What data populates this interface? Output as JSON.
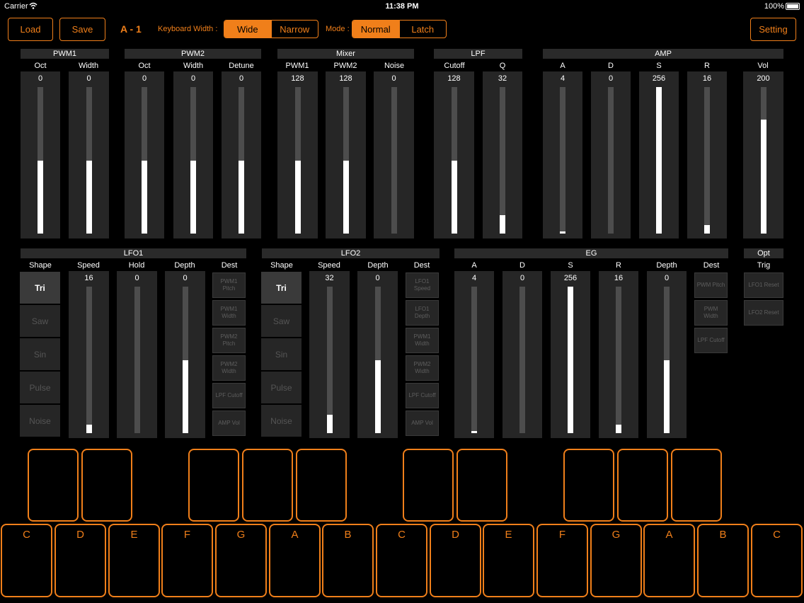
{
  "status": {
    "carrier": "Carrier",
    "time": "11:38 PM",
    "battery": "100%"
  },
  "top": {
    "load": "Load",
    "save": "Save",
    "patch": "A - 1",
    "keyboard_width_label": "Keyboard Width :",
    "wide": "Wide",
    "narrow": "Narrow",
    "mode_label": "Mode :",
    "normal": "Normal",
    "latch": "Latch",
    "setting": "Setting"
  },
  "colors": {
    "accent": "#f07f1a",
    "panel": "#262626",
    "track": "#4d4d4d",
    "header": "#2a2a2a"
  },
  "groups1": [
    "PWM1",
    "PWM2",
    "Mixer",
    "LPF",
    "AMP"
  ],
  "sliders1": [
    {
      "label": "Oct",
      "value": "0",
      "level": 0.5
    },
    {
      "label": "Width",
      "value": "0",
      "level": 0.5
    },
    {
      "label": "Oct",
      "value": "0",
      "level": 0.5
    },
    {
      "label": "Width",
      "value": "0",
      "level": 0.5
    },
    {
      "label": "Detune",
      "value": "0",
      "level": 0.5
    },
    {
      "label": "PWM1",
      "value": "128",
      "level": 0.5
    },
    {
      "label": "PWM2",
      "value": "128",
      "level": 0.5
    },
    {
      "label": "Noise",
      "value": "0",
      "level": 0
    },
    {
      "label": "Cutoff",
      "value": "128",
      "level": 0.5
    },
    {
      "label": "Q",
      "value": "32",
      "level": 0.125
    },
    {
      "label": "A",
      "value": "4",
      "level": 0.016
    },
    {
      "label": "D",
      "value": "0",
      "level": 0
    },
    {
      "label": "S",
      "value": "256",
      "level": 1
    },
    {
      "label": "R",
      "value": "16",
      "level": 0.06
    },
    {
      "label": "Vol",
      "value": "200",
      "level": 0.78
    }
  ],
  "groups2": [
    "LFO1",
    "LFO2",
    "EG",
    "Opt"
  ],
  "labels2": [
    "Shape",
    "Speed",
    "Hold",
    "Depth",
    "Dest",
    "Shape",
    "Speed",
    "Depth",
    "Dest",
    "A",
    "D",
    "S",
    "R",
    "Depth",
    "Dest",
    "Trig"
  ],
  "sliders2": [
    {
      "value": "16",
      "level": 0.06
    },
    {
      "value": "0",
      "level": 0
    },
    {
      "value": "0",
      "level": 0.5
    },
    {
      "value": "32",
      "level": 0.125
    },
    {
      "value": "0",
      "level": 0.5
    },
    {
      "value": "4",
      "level": 0.016
    },
    {
      "value": "0",
      "level": 0
    },
    {
      "value": "256",
      "level": 1
    },
    {
      "value": "16",
      "level": 0.06
    },
    {
      "value": "0",
      "level": 0.5
    }
  ],
  "lfo1_shapes": [
    "Tri",
    "Saw",
    "Sin",
    "Pulse",
    "Noise"
  ],
  "lfo2_shapes": [
    "Tri",
    "Saw",
    "Sin",
    "Pulse",
    "Noise"
  ],
  "selected_shape": "Tri",
  "lfo1_dest": [
    "PWM1 Pitch",
    "PWM1 Width",
    "PWM2 Pitch",
    "PWM2 Width",
    "LPF Cutoff",
    "AMP Vol"
  ],
  "lfo2_dest": [
    "LFO1 Speed",
    "LFO1 Depth",
    "PWM1 Width",
    "PWM2 Width",
    "LPF Cutoff",
    "AMP Vol"
  ],
  "eg_dest": [
    "PWM Pitch",
    "PWM Width",
    "LPF Cutoff"
  ],
  "trig": [
    "LFO1 Reset",
    "LFO2 Reset"
  ],
  "white_keys": [
    "C",
    "D",
    "E",
    "F",
    "G",
    "A",
    "B",
    "C",
    "D",
    "E",
    "F",
    "G",
    "A",
    "B",
    "C"
  ]
}
